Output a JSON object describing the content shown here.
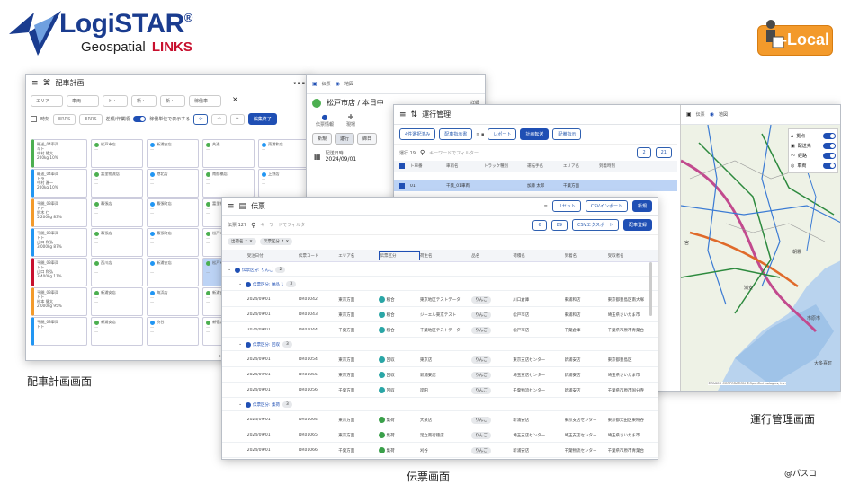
{
  "logo": {
    "name": "LogiSTAR",
    "reg": "®",
    "tagline": "Geospatial",
    "brand": "LINKS",
    "local_badge": "-Local"
  },
  "colors": {
    "navy": "#1a3c8f",
    "red": "#c8102e",
    "orange": "#f39a2b",
    "primary": "#1f4fb4"
  },
  "haisha": {
    "title": "配車計画",
    "filters": [
      "エリア",
      "車両",
      "ト・",
      "新・",
      "新・",
      "稼働車"
    ],
    "toolbar": {
      "check": "時刻",
      "a": "ERRS",
      "b": "ERRS",
      "toggle": "差積/作業順",
      "toggle_text": "稼働単位で表示する",
      "adjust": "編集終了"
    },
    "vehicles": [
      {
        "name": "輸送_04車両",
        "l1": "キト",
        "l2": "中村 隆太",
        "cap": "200kg",
        "pct": "10%"
      },
      {
        "name": "輸送_04車両",
        "l1": "トラ",
        "l2": "中村 進一",
        "cap": "200kg",
        "pct": "10%"
      },
      {
        "name": "平開_03車両",
        "l1": "トト",
        "l2": "鈴木 仁",
        "cap": "5,200kg",
        "pct": "83%"
      },
      {
        "name": "平開_03車両",
        "l1": "トト",
        "l2": "山口 和弘",
        "cap": "3,000kg",
        "pct": "87%"
      },
      {
        "name": "平開_03車両",
        "l1": "トト",
        "l2": "山口 和弘",
        "cap": "3,400kg",
        "pct": "11%"
      },
      {
        "name": "平開_03車両",
        "l1": "トト",
        "l2": "松本 健太",
        "cap": "2,000kg",
        "pct": "95%"
      },
      {
        "name": "平開_03車両",
        "l1": "トト",
        "l2": "",
        "cap": "",
        "pct": ""
      }
    ],
    "stops": [
      [
        "松戸市店",
        "新浦安店",
        "共通",
        "東浦和店"
      ],
      [
        "富里物流店",
        "港北店",
        "南船橋店",
        "上野店"
      ],
      [
        "幕張店",
        "幕張町店",
        "富里物流店"
      ],
      [
        "幕張店",
        "幕張町店",
        "松戸市店"
      ],
      [
        "西川店",
        "新浦安店",
        "松戸市店"
      ],
      [
        "新浦安店",
        "海浜店",
        "新浦安店"
      ],
      [
        "新浦安店",
        "渋谷",
        "新宿店"
      ]
    ],
    "footer": "© 2022 PASCO CORPORATION. ALL RIGHTS RESERVED."
  },
  "denpyo_mid": {
    "tabs": [
      "伝票",
      "地図"
    ],
    "store": "松戸市店 / 本日中",
    "more": "詳細",
    "icons": [
      "伝票情報",
      "現場",
      "出荷"
    ],
    "subtabs": [
      "新規",
      "進行",
      "締日"
    ],
    "date_label": "配送日時",
    "date": "2024/09/01"
  },
  "unko": {
    "title": "運行管理",
    "toolbar": [
      "4件選択済み",
      "配車指示書",
      "レポート",
      "計画転送",
      "配備指示"
    ],
    "search_placeholder": "キーワードでフィルター",
    "count": "運行 19",
    "right_btns": [
      "2",
      "21"
    ],
    "columns": [
      "ト車番",
      "車両名",
      "トラック種別",
      "運転手名",
      "エリア名",
      "到着時刻"
    ],
    "row": [
      "01",
      "千葉_01車両",
      "",
      "加藤 太郎",
      "千葉方面",
      ""
    ],
    "map_tabs": [
      "伝票",
      "地図"
    ],
    "layers": [
      {
        "label": "拠点",
        "icon": "home-icon"
      },
      {
        "label": "配送先",
        "icon": "store-icon"
      },
      {
        "label": "経路",
        "icon": "route-icon"
      },
      {
        "label": "車両",
        "icon": "pin-icon"
      }
    ],
    "map_labels": [
      "宮",
      "朝霧",
      "浦安",
      "大多喜町",
      "市原市"
    ],
    "map_credit": "©PASCO CORPORATION ©OpenTechnologies, Inc."
  },
  "denpyo": {
    "title": "伝票",
    "count": "伝票 127",
    "search_placeholder": "キーワードでフィルター",
    "buttons": {
      "reset": "リセット",
      "csv_in": "CSVインポート",
      "new": "新規",
      "filter": "6",
      "cols": "89",
      "csv_out": "CSVエクスポート",
      "assign": "配車登録"
    },
    "chips": [
      "出荷名 ↑",
      "伝票区分 ↑"
    ],
    "columns": [
      "受注日付",
      "伝票コード",
      "エリア名",
      "伝票区分",
      "荷主名",
      "品名",
      "荷積名",
      "到着名",
      "受取者名"
    ],
    "groups": [
      {
        "label": "伝票区分: りんご",
        "count": "2"
      },
      {
        "label": "伝票区分: 納品 1",
        "count": "3"
      },
      {
        "label": "伝票区分: 回収",
        "count": "3"
      },
      {
        "label": "伝票区分: 集荷",
        "count": "3"
      }
    ],
    "rows": [
      [
        "2024/09/01",
        "DR01042",
        "東京方面",
        "積合",
        "東京地区テストデータ",
        "りんご",
        "川口倉庫",
        "東浦和店",
        "東京都豊島区南大塚"
      ],
      [
        "2024/09/01",
        "DR01043",
        "東京方面",
        "積合",
        "ジーエル東京テスト",
        "りんご",
        "松戸市店",
        "東浦和店",
        "埼玉県さいたま市"
      ],
      [
        "2024/09/01",
        "DR01044",
        "千葉方面",
        "積合",
        "千葉地区テストデータ",
        "りんご",
        "松戸市店",
        "千葉倉庫",
        "千葉県市原市青葉台"
      ],
      [
        "2024/09/01",
        "DR01054",
        "東京方面",
        "回収",
        "東京店",
        "りんご",
        "東京支店センター",
        "新浦安店",
        "東京都豊島区"
      ],
      [
        "2024/09/01",
        "DR01055",
        "東京方面",
        "回収",
        "新浦安店",
        "りんご",
        "埼玉支店センター",
        "新浦安店",
        "埼玉県さいたま市"
      ],
      [
        "2024/09/01",
        "DR01056",
        "千葉方面",
        "回収",
        "岸田",
        "りんご",
        "千葉物流センター",
        "新浦安店",
        "千葉県市原市国分寺"
      ],
      [
        "2024/09/01",
        "DR01064",
        "東京方面",
        "集荷",
        "大泉店",
        "りんご",
        "新浦安店",
        "東京支店センター",
        "東京都大田区東糀谷"
      ],
      [
        "2024/09/01",
        "DR01065",
        "東京方面",
        "集荷",
        "足立南行徳店",
        "りんご",
        "埼玉支店センター",
        "埼玉支店センター",
        "埼玉県さいたま市"
      ],
      [
        "2024/09/01",
        "DR01066",
        "千葉方面",
        "集荷",
        "刈谷",
        "りんご",
        "新浦安店",
        "千葉物流センター",
        "千葉県市原市青葉台"
      ]
    ]
  },
  "captions": {
    "haisha": "配車計画画面",
    "unko": "運行管理画面",
    "denpyo": "伝票画面",
    "credit": "@パスコ"
  }
}
